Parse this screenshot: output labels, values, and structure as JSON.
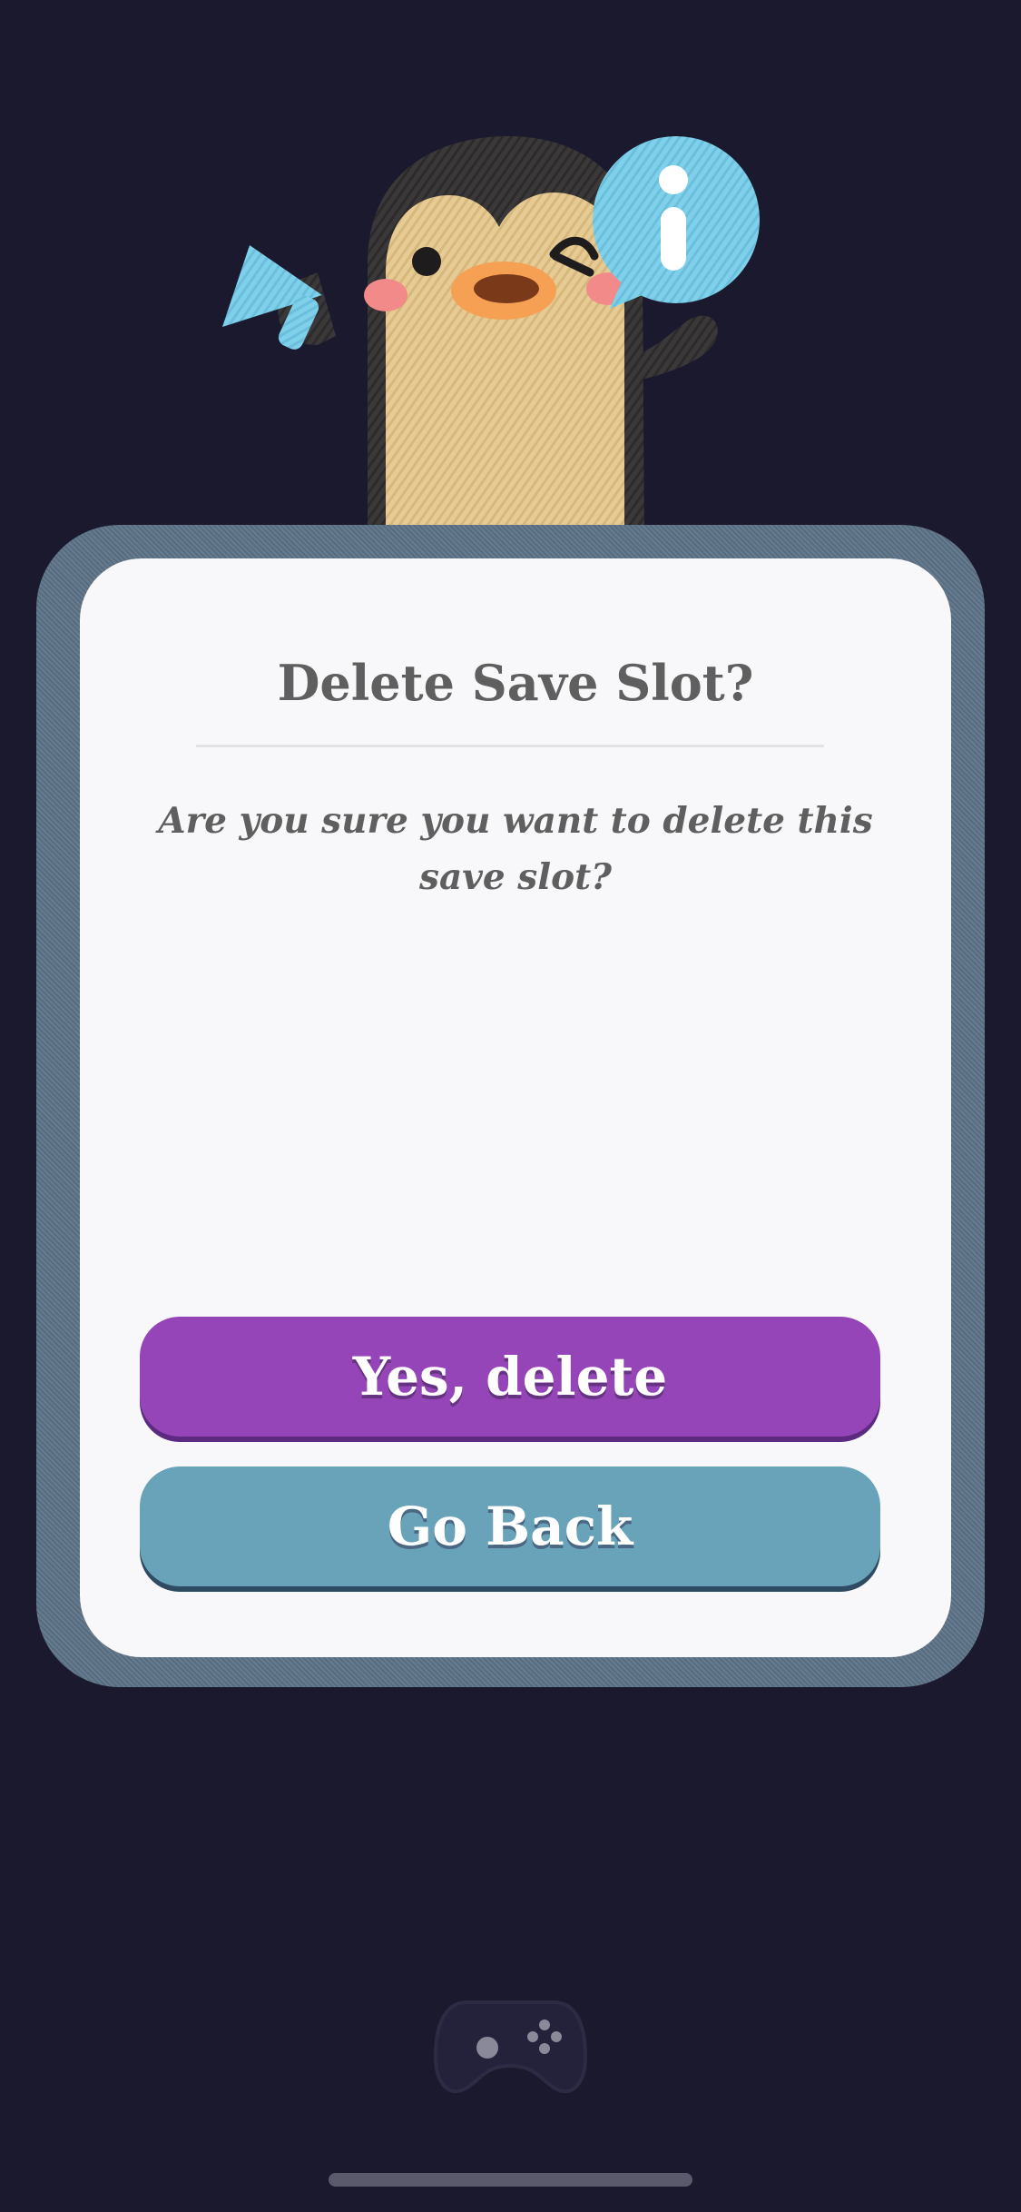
{
  "dialog": {
    "title": "Delete Save Slot?",
    "message": "Are you sure you want to delete this save slot?",
    "confirm_label": "Yes, delete",
    "cancel_label": "Go Back"
  },
  "icons": {
    "mascot": "penguin-mascot",
    "info_bubble": "info-icon",
    "megaphone": "megaphone-icon",
    "bottom_nav": "gamepad-icon"
  },
  "colors": {
    "background": "#1b192d",
    "frame": "#5d7388",
    "card": "#f8f8fa",
    "text": "#5f5f5f",
    "confirm_button": "#9645b8",
    "cancel_button": "#68a3ba"
  }
}
